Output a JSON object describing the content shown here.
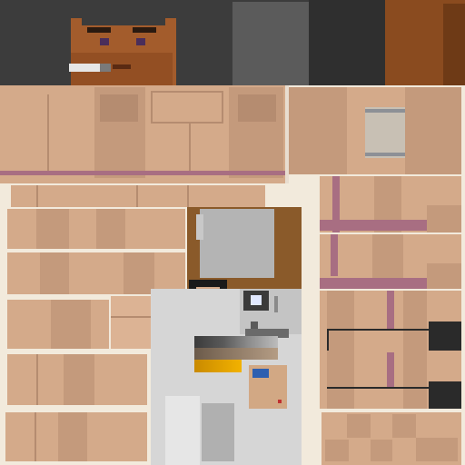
{
  "texture": {
    "kind": "skin-atlas",
    "regions": [
      "head-top-strip",
      "face",
      "cigarette",
      "torso-front",
      "arm-panels",
      "leg-panels",
      "hud-panel",
      "pocket-panel"
    ]
  },
  "palette": {
    "skin": "#d4aa8a",
    "skin_dark": "#c49a7c",
    "stripe": "#a86e82",
    "hair": "#3c3c3c",
    "face": "#a35c2c",
    "wood": "#8a5a2a",
    "gold": "#e8a400",
    "screen_gray": "#b4b4b4",
    "blue_chip": "#2e5fb0",
    "dark_block": "#2a2a2a"
  },
  "icons": [
    "target-icon",
    "screen-icon",
    "chip-icon"
  ]
}
